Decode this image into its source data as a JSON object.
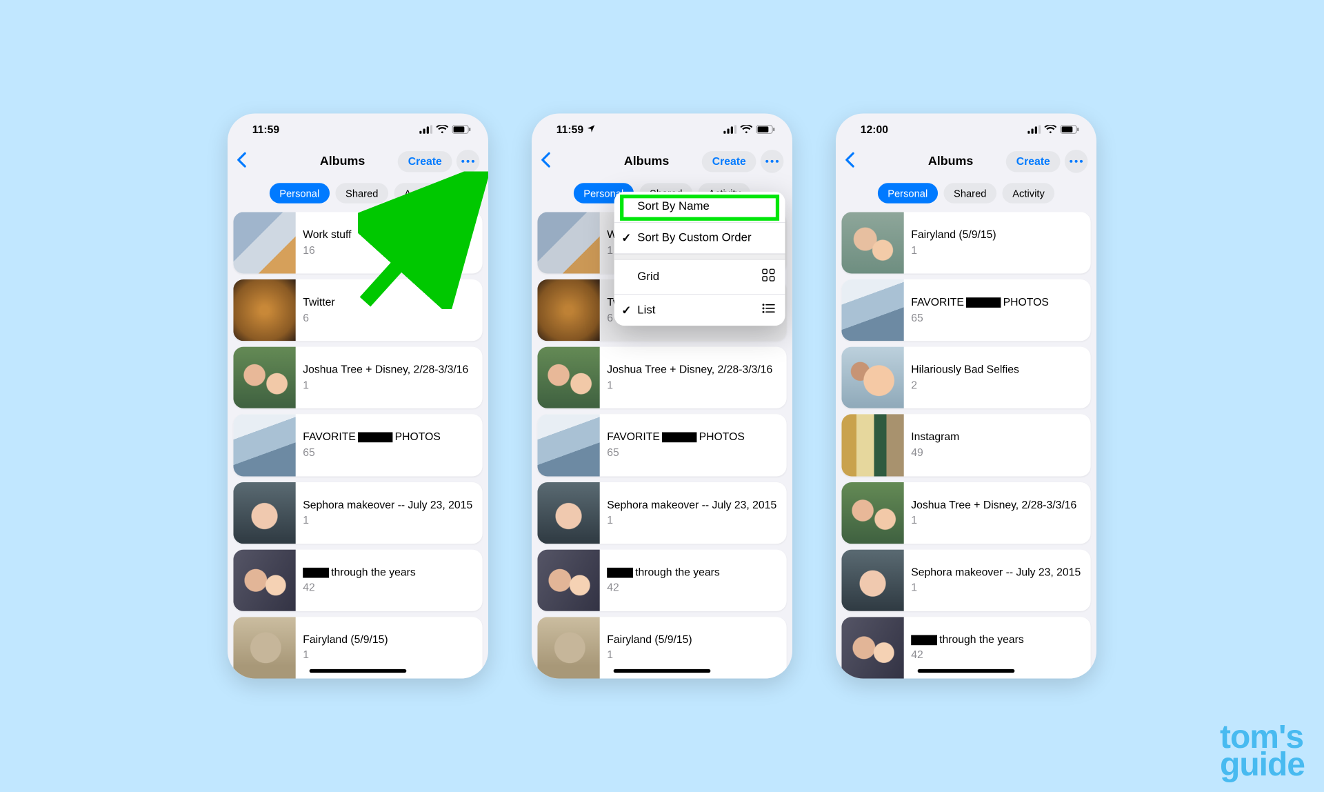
{
  "watermark_line1": "tom's",
  "watermark_line2": "guide",
  "phones": [
    {
      "time": "11:59",
      "show_location": false,
      "title": "Albums",
      "create_label": "Create",
      "tabs": [
        "Personal",
        "Shared",
        "Activity"
      ],
      "active_tab": 0,
      "show_arrow": true,
      "show_menu": false,
      "albums": [
        {
          "title_parts": [
            {
              "t": "Work stuff"
            }
          ],
          "count": "16",
          "thumb": "th-workstuff"
        },
        {
          "title_parts": [
            {
              "t": "Twitter"
            }
          ],
          "count": "6",
          "thumb": "th-twitter"
        },
        {
          "title_parts": [
            {
              "t": "Joshua Tree + Disney, 2/28-3/3/16"
            }
          ],
          "count": "1",
          "thumb": "th-joshua"
        },
        {
          "title_parts": [
            {
              "t": "FAVORITE"
            },
            {
              "r": 48
            },
            {
              "t": "PHOTOS"
            }
          ],
          "count": "65",
          "thumb": "th-favorite"
        },
        {
          "title_parts": [
            {
              "t": "Sephora makeover -- July 23, 2015"
            }
          ],
          "count": "1",
          "thumb": "th-sephora"
        },
        {
          "title_parts": [
            {
              "r": 36
            },
            {
              "t": "through the years"
            }
          ],
          "count": "42",
          "thumb": "th-through"
        },
        {
          "title_parts": [
            {
              "t": "Fairyland (5/9/15)"
            }
          ],
          "count": "1",
          "thumb": "th-fairyland"
        }
      ]
    },
    {
      "time": "11:59",
      "show_location": true,
      "title": "Albums",
      "create_label": "Create",
      "tabs": [
        "Personal",
        "Shared",
        "Activity"
      ],
      "active_tab": 0,
      "show_arrow": false,
      "show_menu": true,
      "menu": {
        "sort_name": "Sort By Name",
        "sort_custom": "Sort By Custom Order",
        "grid": "Grid",
        "list": "List",
        "checked": 1,
        "view_checked": 1
      },
      "albums": [
        {
          "title_parts": [
            {
              "t": "W"
            }
          ],
          "count": "1",
          "thumb": "th-workstuff",
          "dimmed": true
        },
        {
          "title_parts": [
            {
              "t": "Twitter"
            }
          ],
          "count": "6",
          "thumb": "th-twitter",
          "dimmed": true
        },
        {
          "title_parts": [
            {
              "t": "Joshua Tree + Disney, 2/28-3/3/16"
            }
          ],
          "count": "1",
          "thumb": "th-joshua"
        },
        {
          "title_parts": [
            {
              "t": "FAVORITE"
            },
            {
              "r": 48
            },
            {
              "t": "PHOTOS"
            }
          ],
          "count": "65",
          "thumb": "th-favorite"
        },
        {
          "title_parts": [
            {
              "t": "Sephora makeover -- July 23, 2015"
            }
          ],
          "count": "1",
          "thumb": "th-sephora"
        },
        {
          "title_parts": [
            {
              "r": 36
            },
            {
              "t": "through the years"
            }
          ],
          "count": "42",
          "thumb": "th-through"
        },
        {
          "title_parts": [
            {
              "t": "Fairyland (5/9/15)"
            }
          ],
          "count": "1",
          "thumb": "th-fairyland"
        }
      ]
    },
    {
      "time": "12:00",
      "show_location": false,
      "title": "Albums",
      "create_label": "Create",
      "tabs": [
        "Personal",
        "Shared",
        "Activity"
      ],
      "active_tab": 0,
      "show_arrow": false,
      "show_menu": false,
      "albums": [
        {
          "title_parts": [
            {
              "t": "Fairyland (5/9/15)"
            }
          ],
          "count": "1",
          "thumb": "th-fairyland2"
        },
        {
          "title_parts": [
            {
              "t": "FAVORITE"
            },
            {
              "r": 48
            },
            {
              "t": "PHOTOS"
            }
          ],
          "count": "65",
          "thumb": "th-favorite"
        },
        {
          "title_parts": [
            {
              "t": "Hilariously Bad Selfies"
            }
          ],
          "count": "2",
          "thumb": "th-hilarious"
        },
        {
          "title_parts": [
            {
              "t": "Instagram"
            }
          ],
          "count": "49",
          "thumb": "th-instagram"
        },
        {
          "title_parts": [
            {
              "t": "Joshua Tree + Disney, 2/28-3/3/16"
            }
          ],
          "count": "1",
          "thumb": "th-joshua"
        },
        {
          "title_parts": [
            {
              "t": "Sephora makeover -- July 23, 2015"
            }
          ],
          "count": "1",
          "thumb": "th-sephora"
        },
        {
          "title_parts": [
            {
              "r": 36
            },
            {
              "t": "through the years"
            }
          ],
          "count": "42",
          "thumb": "th-through"
        }
      ]
    }
  ]
}
